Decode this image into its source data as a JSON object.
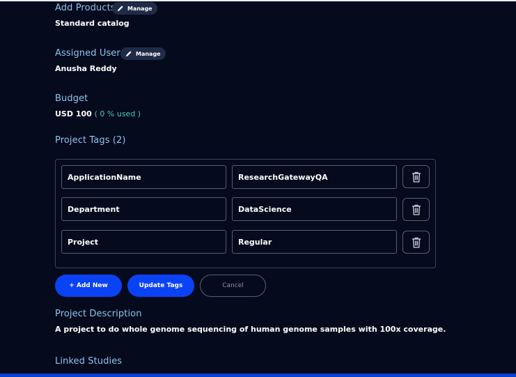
{
  "add_products": {
    "title": "Add Products",
    "manage_label": "Manage",
    "value": "Standard catalog"
  },
  "assigned_users": {
    "title": "Assigned Users",
    "manage_label": "Manage",
    "value": "Anusha Reddy"
  },
  "budget": {
    "title": "Budget",
    "amount": "USD 100",
    "used": "( 0 % used )"
  },
  "project_tags": {
    "title": "Project Tags (2)",
    "rows": [
      {
        "key": "ApplicationName",
        "value": "ResearchGatewayQA"
      },
      {
        "key": "Department",
        "value": "DataScience"
      },
      {
        "key": "Project",
        "value": "Regular"
      }
    ],
    "add_new_label": "+ Add New",
    "update_label": "Update Tags",
    "cancel_label": "Cancel"
  },
  "project_description": {
    "title": "Project Description",
    "value": "A project to do whole genome sequencing of human genome samples with 100x coverage."
  },
  "linked_studies": {
    "title": "Linked Studies"
  },
  "colors": {
    "background": "#050a1c",
    "heading": "#8ec4ee",
    "accent": "#0a42f5",
    "used_text": "#3fd0b0"
  },
  "icons": [
    "pencil-icon",
    "trash-icon"
  ]
}
